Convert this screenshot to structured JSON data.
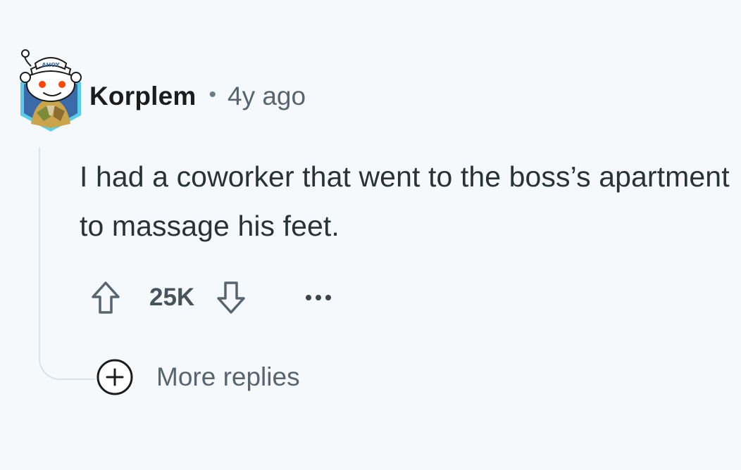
{
  "comment": {
    "avatar": {
      "icon": "snoo-sailor-avatar-icon",
      "hat_text": "AHOY"
    },
    "author": "Korplem",
    "separator": "•",
    "time_ago": "4y ago",
    "body": "I had a coworker that went to the boss’s apartment to massage his feet.",
    "actions": {
      "upvote_icon": "upvote-arrow-icon",
      "score": "25K",
      "downvote_icon": "downvote-arrow-icon",
      "more_icon": "more-dots-icon"
    },
    "more_replies": {
      "icon": "plus-circle-icon",
      "label": "More replies"
    }
  },
  "colors": {
    "background": "#f6f9fc",
    "text_primary": "#1c1c1c",
    "text_body": "#2a3236",
    "text_secondary": "#58646e",
    "thread_line": "#dbe2e7",
    "avatar_frame": "#5ccde6"
  }
}
